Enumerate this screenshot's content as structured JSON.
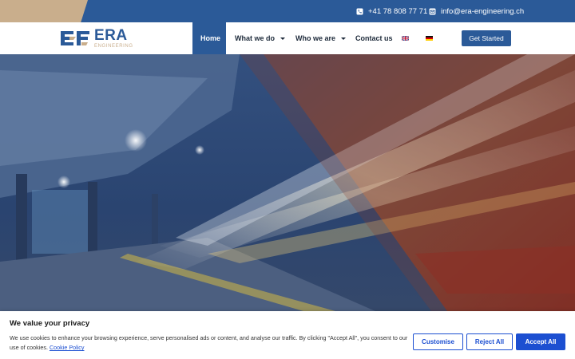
{
  "topbar": {
    "phone": "+41 78 808 77 71",
    "email": "info@era-engineering.ch",
    "phone_icon": "phone-icon",
    "email_icon": "envelope-icon"
  },
  "logo": {
    "name": "ERA",
    "tagline": "ENGINEERING"
  },
  "nav": {
    "items": [
      {
        "label": "Home",
        "active": true
      },
      {
        "label": "What we do",
        "dropdown": true
      },
      {
        "label": "Who we are",
        "dropdown": true
      },
      {
        "label": "Contact us"
      }
    ],
    "languages": [
      "en-flag-icon",
      "de-flag-icon"
    ],
    "cta": "Get Started"
  },
  "hero": {
    "image": "train-station-light-trails"
  },
  "cookie": {
    "title": "We value your privacy",
    "text": "We use cookies to enhance your browsing experience, serve personalised ads or content, and analyse our traffic. By clicking \"Accept All\", you consent to our use of cookies.",
    "link": "Cookie Policy",
    "customise": "Customise",
    "reject": "Reject All",
    "accept": "Accept All"
  },
  "colors": {
    "brand_blue": "#2b5a98",
    "brand_tan": "#c9ae8c",
    "cookie_blue": "#1c4fd1"
  }
}
